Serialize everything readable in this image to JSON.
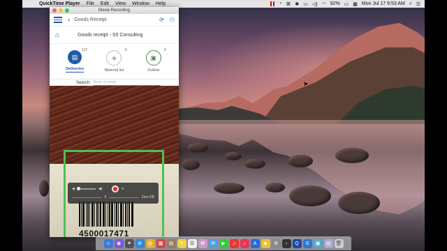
{
  "menubar": {
    "app_name": "QuickTime Player",
    "items": [
      "File",
      "Edit",
      "View",
      "Window",
      "Help"
    ],
    "battery": "92%",
    "clock": "Mon Jul 17  9:53 AM"
  },
  "window": {
    "title": "Movie Recording"
  },
  "app": {
    "header_title": "Goods Receipt",
    "subtitle": "Goods receipt - S5 Consulting",
    "tiles": [
      {
        "label": "Deliveries",
        "count": "117"
      },
      {
        "label": "Material list",
        "count": "0"
      },
      {
        "label": "Outbox",
        "count": "0"
      }
    ],
    "search_label": "Search:",
    "search_placeholder": "Scan or enter"
  },
  "recording": {
    "size_label": "Zero KB",
    "timer": "II"
  },
  "scan": {
    "barcode_number": "4500017471"
  },
  "colors": {
    "accent": "#1f5aa6",
    "scan_frame": "#4fc14f",
    "record": "#e22222"
  }
}
